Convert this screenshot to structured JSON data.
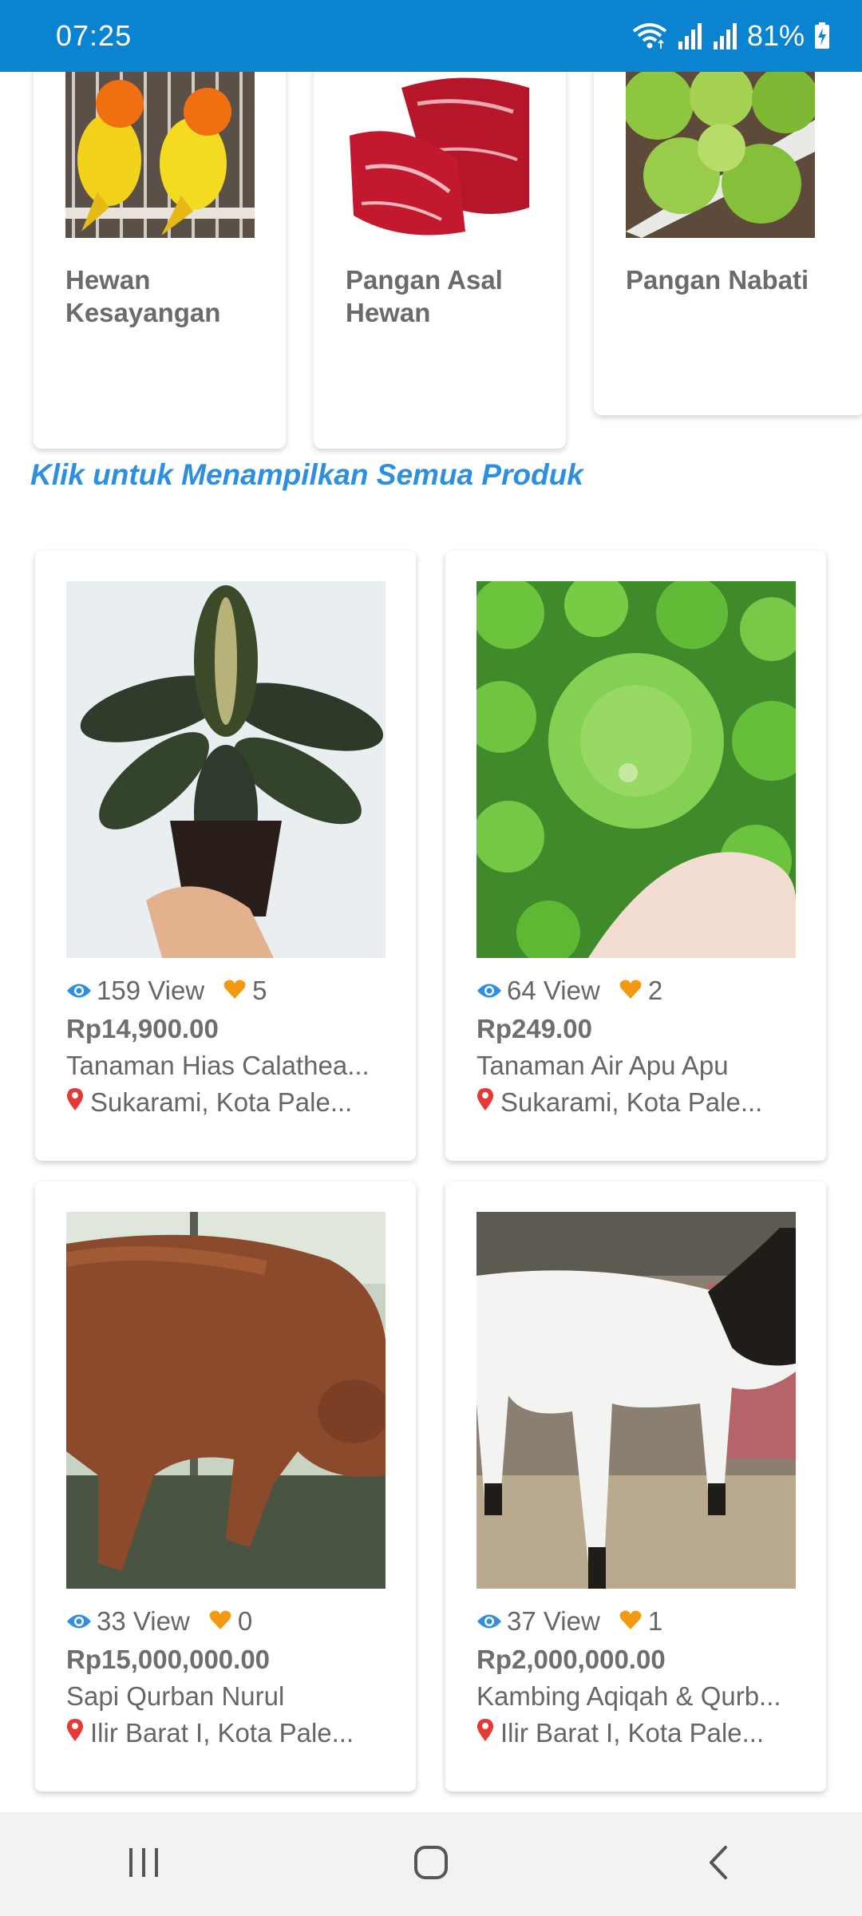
{
  "status_bar": {
    "time": "07:25",
    "battery": "81%",
    "icons": [
      "wifi-icon",
      "signal-icon",
      "signal-icon",
      "battery-charging-icon"
    ]
  },
  "categories": [
    {
      "label": "Hewan Kesayangan",
      "image": "lovebirds-photo"
    },
    {
      "label": "Pangan Asal Hewan",
      "image": "raw-beef-photo"
    },
    {
      "label": "Pangan Nabati",
      "image": "lettuce-photo"
    }
  ],
  "show_all_link": "Klik untuk Menampilkan Semua Produk",
  "products": [
    {
      "views": "159 View",
      "likes": "5",
      "price": "Rp14,900.00",
      "name": "Tanaman Hias Calathea...",
      "location": "Sukarami, Kota Pale...",
      "image": "calathea-plant-photo"
    },
    {
      "views": "64 View",
      "likes": "2",
      "price": "Rp249.00",
      "name": "Tanaman Air Apu Apu",
      "location": "Sukarami, Kota Pale...",
      "image": "water-lettuce-photo"
    },
    {
      "views": "33 View",
      "likes": "0",
      "price": "Rp15,000,000.00",
      "name": "Sapi Qurban Nurul",
      "location": "Ilir Barat I, Kota Pale...",
      "image": "brown-cow-photo"
    },
    {
      "views": "37 View",
      "likes": "1",
      "price": "Rp2,000,000.00",
      "name": "Kambing Aqiqah & Qurb...",
      "location": "Ilir Barat I, Kota Pale...",
      "image": "white-goat-photo"
    }
  ],
  "colors": {
    "status_bar": "#0a84d0",
    "link": "#2e8fe0",
    "eye": "#2e8fe0",
    "heart": "#f39a12",
    "pin": "#e53935"
  },
  "nav": [
    "recent-apps-icon",
    "home-icon",
    "back-icon"
  ]
}
